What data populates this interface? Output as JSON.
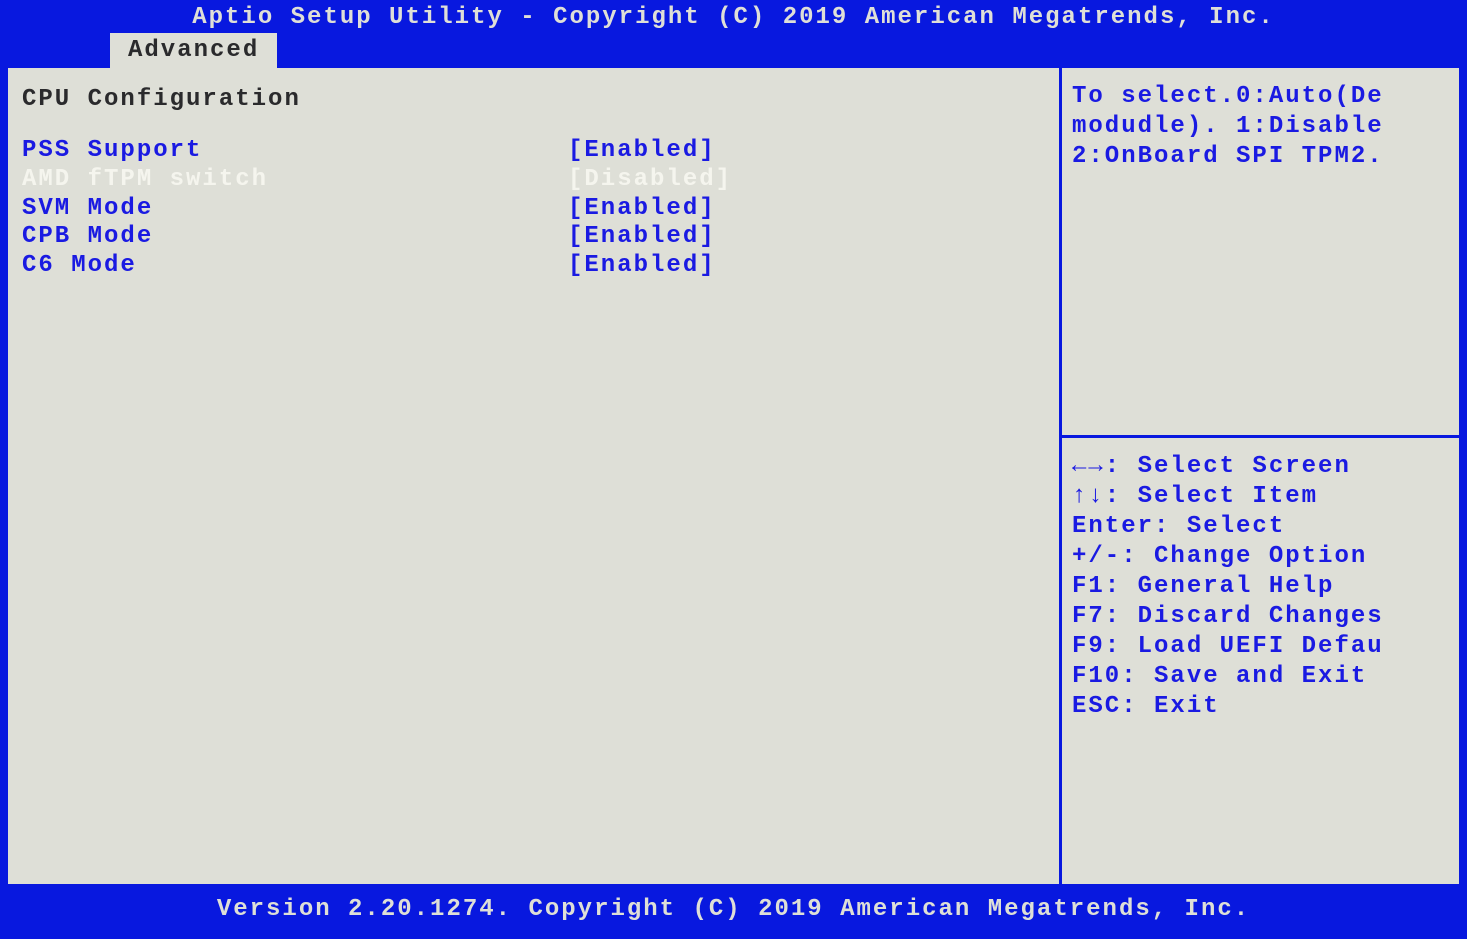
{
  "header": {
    "title": "Aptio Setup Utility - Copyright (C) 2019 American Megatrends, Inc.",
    "tab_label": "Advanced"
  },
  "main": {
    "section_title": "CPU Configuration",
    "options": [
      {
        "label": "PSS Support",
        "value": "[Enabled]",
        "selected": false
      },
      {
        "label": "AMD fTPM switch",
        "value": "[Disabled]",
        "selected": true
      },
      {
        "label": "SVM Mode",
        "value": "[Enabled]",
        "selected": false
      },
      {
        "label": "CPB Mode",
        "value": "[Enabled]",
        "selected": false
      },
      {
        "label": "C6 Mode",
        "value": "[Enabled]",
        "selected": false
      }
    ]
  },
  "help": {
    "line1": "To select.0:Auto(De",
    "line2": "modudle). 1:Disable",
    "line3": "2:OnBoard SPI TPM2."
  },
  "keys": {
    "k1": "←→: Select Screen",
    "k2": "↑↓: Select Item",
    "k3": "Enter: Select",
    "k4": "+/-: Change Option",
    "k5": "F1: General Help",
    "k6": "F7: Discard Changes",
    "k7": "F9: Load UEFI Defau",
    "k8": "F10: Save and Exit",
    "k9": "ESC: Exit"
  },
  "footer": {
    "text": "Version 2.20.1274. Copyright (C) 2019 American Megatrends, Inc."
  }
}
